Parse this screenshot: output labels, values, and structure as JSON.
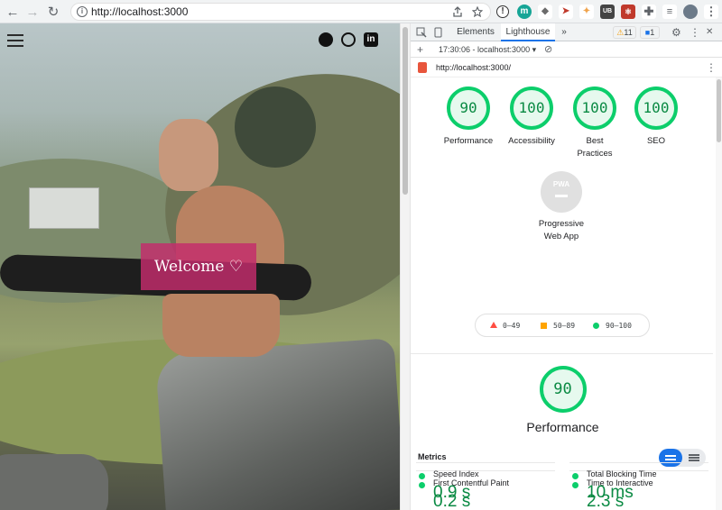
{
  "browser": {
    "url": "http://localhost:3000",
    "nav": {
      "back": "←",
      "forward": "→",
      "reload": "↻"
    }
  },
  "site": {
    "welcome": "Welcome ♡",
    "menu_icon": "hamburger-menu-icon",
    "social": [
      {
        "name": "github-icon",
        "glyph": "GH"
      },
      {
        "name": "whatsapp-icon",
        "glyph": "WA"
      },
      {
        "name": "linkedin-icon",
        "glyph": "in"
      }
    ]
  },
  "devtools": {
    "tabs": [
      "Elements",
      "Lighthouse"
    ],
    "more_tabs": "»",
    "warnings_count": "11",
    "messages_count": "1",
    "report_selector": "17:30:06 - localhost:3000",
    "report_url": "http://localhost:3000/",
    "add_label": "+",
    "menu_dots": "⋮",
    "close": "✕"
  },
  "lighthouse": {
    "categories": [
      {
        "score": "90",
        "label": "Performance"
      },
      {
        "score": "100",
        "label": "Accessibility"
      },
      {
        "score": "100",
        "label": "Best Practices"
      },
      {
        "score": "100",
        "label": "SEO"
      }
    ],
    "pwa": {
      "badge": "PWA",
      "label": "Progressive Web App"
    },
    "legend": [
      {
        "range": "0–49",
        "color": "#ff4e42"
      },
      {
        "range": "50–89",
        "color": "#ffa400"
      },
      {
        "range": "90–100",
        "color": "#0cce6b"
      }
    ],
    "performance": {
      "score": "90",
      "title": "Performance"
    },
    "metrics_title": "Metrics",
    "metrics": [
      {
        "label": "First Contentful Paint",
        "value": "0.2 s"
      },
      {
        "label": "Time to Interactive",
        "value": "2.3 s"
      },
      {
        "label": "Speed Index",
        "value": "0.9 s"
      },
      {
        "label": "Total Blocking Time",
        "value": "10 ms"
      }
    ]
  }
}
